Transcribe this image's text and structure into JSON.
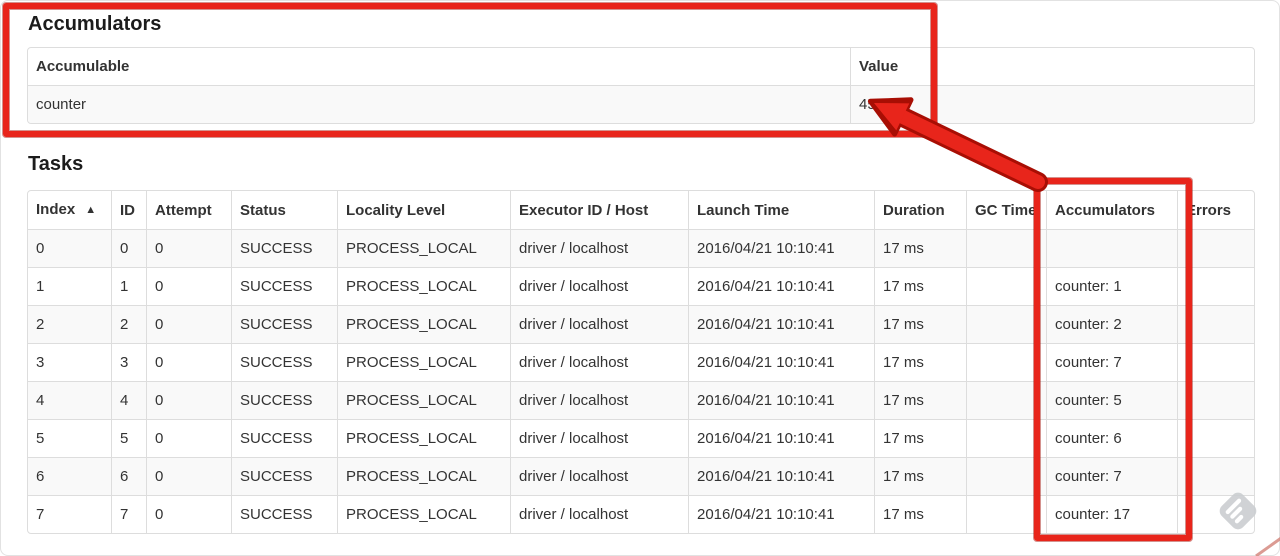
{
  "accumulators_section": {
    "heading": "Accumulators",
    "table": {
      "keys": [
        "accumulable",
        "value"
      ],
      "headers": [
        {
          "label": "Accumulable"
        },
        {
          "label": "Value"
        }
      ],
      "rows": [
        [
          "counter",
          "45"
        ]
      ]
    }
  },
  "tasks_section": {
    "heading": "Tasks",
    "table": {
      "keys": [
        "index",
        "id",
        "attempt",
        "status",
        "locality-level",
        "executor-id-host",
        "launch-time",
        "duration",
        "gc-time",
        "accumulators",
        "errors"
      ],
      "headers": [
        {
          "label": "Index",
          "sort": "▲"
        },
        {
          "label": "ID"
        },
        {
          "label": "Attempt"
        },
        {
          "label": "Status"
        },
        {
          "label": "Locality Level"
        },
        {
          "label": "Executor ID / Host"
        },
        {
          "label": "Launch Time"
        },
        {
          "label": "Duration"
        },
        {
          "label": "GC Time"
        },
        {
          "label": "Accumulators"
        },
        {
          "label": "Errors"
        }
      ],
      "rows": [
        [
          "0",
          "0",
          "0",
          "SUCCESS",
          "PROCESS_LOCAL",
          "driver / localhost",
          "2016/04/21 10:10:41",
          "17 ms",
          "",
          "",
          ""
        ],
        [
          "1",
          "1",
          "0",
          "SUCCESS",
          "PROCESS_LOCAL",
          "driver / localhost",
          "2016/04/21 10:10:41",
          "17 ms",
          "",
          "counter: 1",
          ""
        ],
        [
          "2",
          "2",
          "0",
          "SUCCESS",
          "PROCESS_LOCAL",
          "driver / localhost",
          "2016/04/21 10:10:41",
          "17 ms",
          "",
          "counter: 2",
          ""
        ],
        [
          "3",
          "3",
          "0",
          "SUCCESS",
          "PROCESS_LOCAL",
          "driver / localhost",
          "2016/04/21 10:10:41",
          "17 ms",
          "",
          "counter: 7",
          ""
        ],
        [
          "4",
          "4",
          "0",
          "SUCCESS",
          "PROCESS_LOCAL",
          "driver / localhost",
          "2016/04/21 10:10:41",
          "17 ms",
          "",
          "counter: 5",
          ""
        ],
        [
          "5",
          "5",
          "0",
          "SUCCESS",
          "PROCESS_LOCAL",
          "driver / localhost",
          "2016/04/21 10:10:41",
          "17 ms",
          "",
          "counter: 6",
          ""
        ],
        [
          "6",
          "6",
          "0",
          "SUCCESS",
          "PROCESS_LOCAL",
          "driver / localhost",
          "2016/04/21 10:10:41",
          "17 ms",
          "",
          "counter: 7",
          ""
        ],
        [
          "7",
          "7",
          "0",
          "SUCCESS",
          "PROCESS_LOCAL",
          "driver / localhost",
          "2016/04/21 10:10:41",
          "17 ms",
          "",
          "counter: 17",
          ""
        ]
      ]
    }
  },
  "annotations": {
    "highlight_color": "#e8251b",
    "highlight_outline": "#a80e04",
    "watermark_color": "#cbced1",
    "table_border_color": "#dddddd",
    "stripe_color": "#f9f9f9"
  }
}
